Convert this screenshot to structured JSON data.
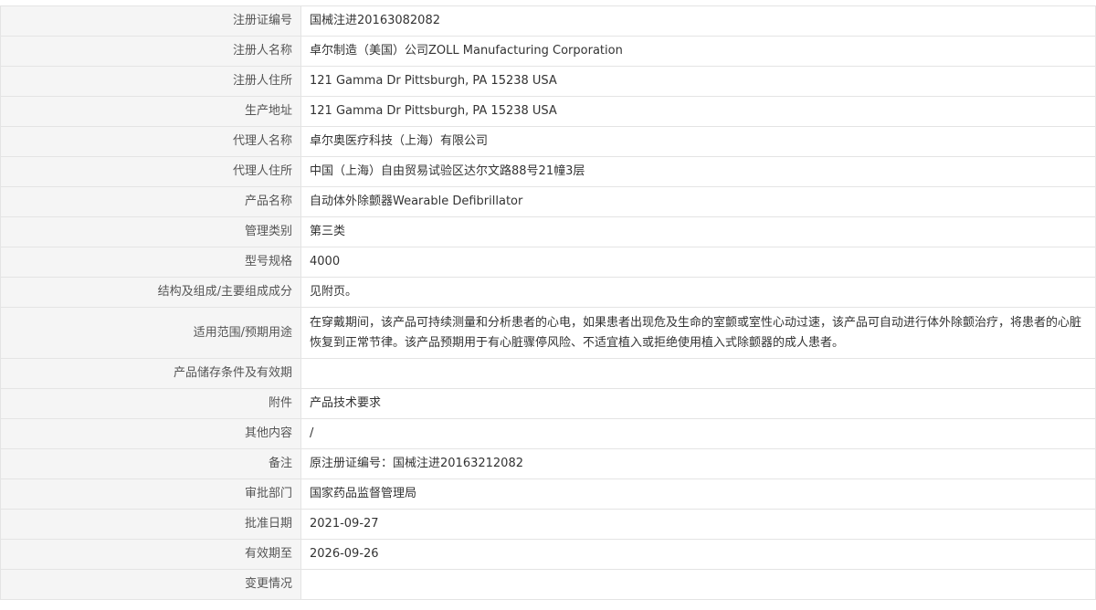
{
  "registration": {
    "rows": [
      {
        "label": "注册证编号",
        "value": "国械注进20163082082"
      },
      {
        "label": "注册人名称",
        "value": "卓尔制造（美国）公司ZOLL Manufacturing Corporation"
      },
      {
        "label": "注册人住所",
        "value": "121 Gamma Dr Pittsburgh, PA 15238 USA"
      },
      {
        "label": "生产地址",
        "value": "121 Gamma Dr Pittsburgh, PA 15238 USA"
      },
      {
        "label": "代理人名称",
        "value": "卓尔奥医疗科技（上海）有限公司"
      },
      {
        "label": "代理人住所",
        "value": "中国（上海）自由贸易试验区达尔文路88号21幢3层"
      },
      {
        "label": "产品名称",
        "value": "自动体外除颤器Wearable Defibrillator"
      },
      {
        "label": "管理类别",
        "value": "第三类"
      },
      {
        "label": "型号规格",
        "value": "4000"
      },
      {
        "label": "结构及组成/主要组成成分",
        "value": "见附页。"
      },
      {
        "label": "适用范围/预期用途",
        "value": "在穿戴期间，该产品可持续测量和分析患者的心电，如果患者出现危及生命的室颤或室性心动过速，该产品可自动进行体外除颤治疗，将患者的心脏恢复到正常节律。该产品预期用于有心脏骤停风险、不适宜植入或拒绝使用植入式除颤器的成人患者。"
      },
      {
        "label": "产品储存条件及有效期",
        "value": ""
      },
      {
        "label": "附件",
        "value": "产品技术要求"
      },
      {
        "label": "其他内容",
        "value": "/"
      },
      {
        "label": "备注",
        "value": "原注册证编号：国械注进20163212082"
      },
      {
        "label": "审批部门",
        "value": "国家药品监督管理局"
      },
      {
        "label": "批准日期",
        "value": "2021-09-27"
      },
      {
        "label": "有效期至",
        "value": "2026-09-26"
      },
      {
        "label": "变更情况",
        "value": ""
      }
    ]
  }
}
